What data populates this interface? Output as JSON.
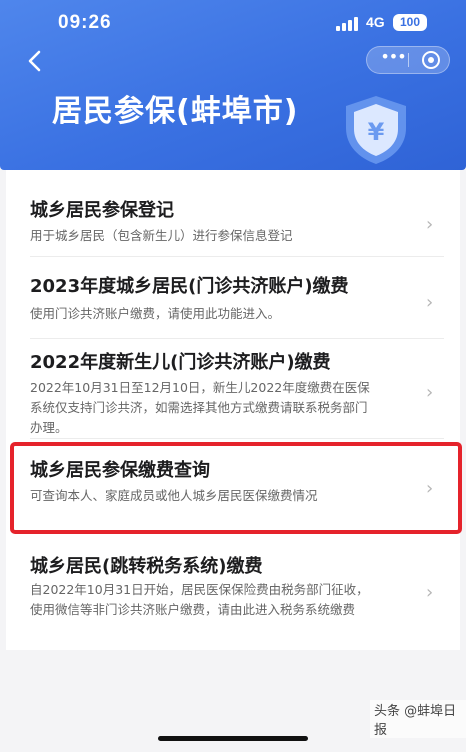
{
  "status_bar": {
    "time": "09:26",
    "network": "4G",
    "battery": "100"
  },
  "header": {
    "title": "居民参保(蚌埠市)",
    "colors": {
      "primary": "#3a71e2",
      "highlight": "#e5232b"
    }
  },
  "menu": [
    {
      "title": "城乡居民参保登记",
      "desc": "用于城乡居民（包含新生儿）进行参保信息登记"
    },
    {
      "title": "2023年度城乡居民(门诊共济账户)缴费",
      "desc": "使用门诊共济账户缴费，请使用此功能进入。"
    },
    {
      "title": "2022年度新生儿(门诊共济账户)缴费",
      "desc": "2022年10月31日至12月10日，新生儿2022年度缴费在医保系统仅支持门诊共济，如需选择其他方式缴费请联系税务部门办理。"
    },
    {
      "title": "城乡居民参保缴费查询",
      "desc": "可查询本人、家庭成员或他人城乡居民医保缴费情况"
    },
    {
      "title": "城乡居民(跳转税务系统)缴费",
      "desc": "自2022年10月31日开始，居民医保保险费由税务部门征收，使用微信等非门诊共济账户缴费，请由此进入税务系统缴费"
    }
  ],
  "watermark": "头条 @蚌埠日报"
}
